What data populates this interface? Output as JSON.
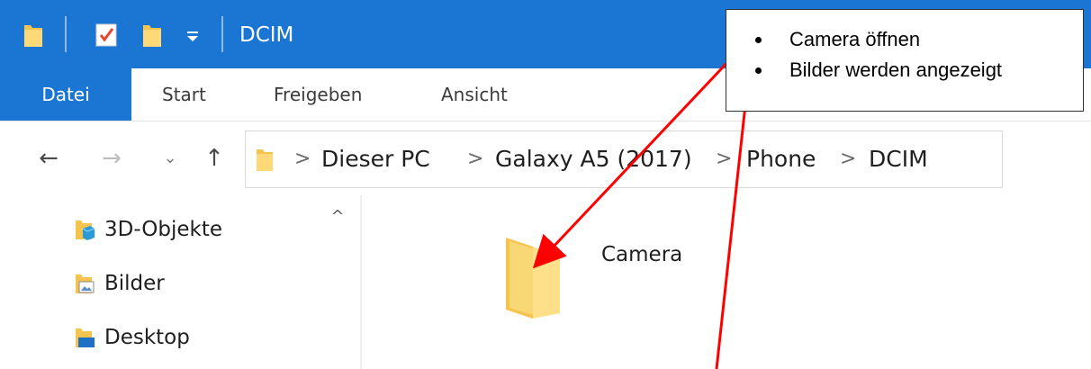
{
  "window": {
    "title": "DCIM"
  },
  "ribbon": {
    "tabs": [
      {
        "label": "Datei",
        "active": true
      },
      {
        "label": "Start"
      },
      {
        "label": "Freigeben"
      },
      {
        "label": "Ansicht"
      }
    ]
  },
  "nav": {
    "back_icon": "arrow-left-icon",
    "forward_icon": "arrow-right-icon",
    "recent_icon": "chevron-down-icon",
    "up_icon": "arrow-up-icon"
  },
  "address": {
    "crumbs": [
      "Dieser PC",
      "Galaxy A5 (2017)",
      "Phone",
      "DCIM"
    ]
  },
  "navpane": {
    "items": [
      {
        "label": "3D-Objekte",
        "icon": "3d-objects-folder-icon"
      },
      {
        "label": "Bilder",
        "icon": "pictures-folder-icon"
      },
      {
        "label": "Desktop",
        "icon": "desktop-folder-icon"
      }
    ]
  },
  "content": {
    "folders": [
      {
        "label": "Camera",
        "icon": "folder-icon"
      }
    ]
  },
  "annotation": {
    "bullets": [
      "Camera öffnen",
      "Bilder werden angezeigt"
    ],
    "arrow_color": "#ff0000"
  },
  "colors": {
    "titlebar": "#1a76d2",
    "folder": "#f8d775"
  }
}
